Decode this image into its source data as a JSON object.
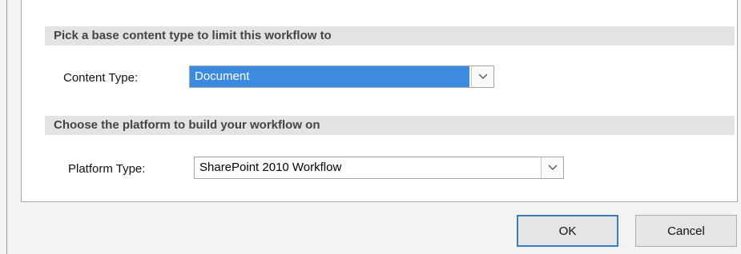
{
  "sections": {
    "content_type": {
      "header": "Pick a base content type to limit this workflow to",
      "label": "Content Type:",
      "value": "Document"
    },
    "platform": {
      "header": "Choose the platform to build your workflow on",
      "label": "Platform Type:",
      "value": "SharePoint 2010 Workflow"
    }
  },
  "buttons": {
    "ok": "OK",
    "cancel": "Cancel"
  },
  "icons": {
    "dropdown": "chevron-down-icon"
  },
  "colors": {
    "selection": "#3c8be0",
    "default_button_border": "#3d7bbd",
    "section_header_bg": "#e3e3e3"
  }
}
